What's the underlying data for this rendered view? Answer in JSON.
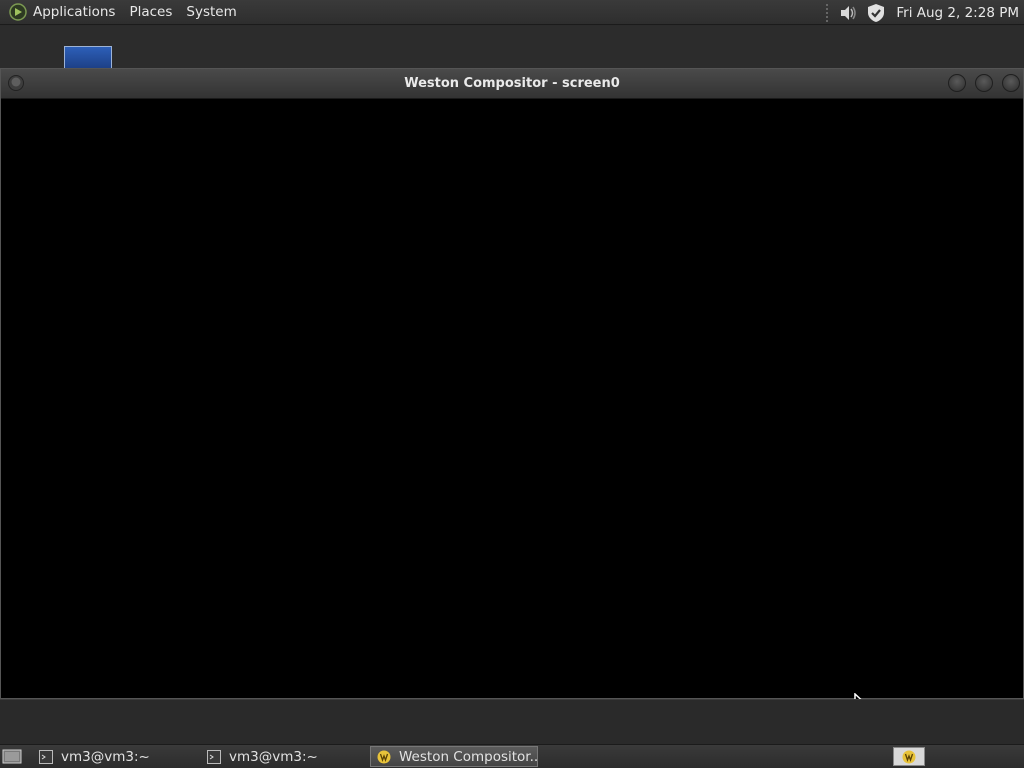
{
  "top_panel": {
    "menus": [
      "Applications",
      "Places",
      "System"
    ],
    "clock": "Fri Aug  2,  2:28 PM"
  },
  "window": {
    "title": "Weston Compositor - screen0"
  },
  "taskbar": {
    "tasks": [
      {
        "label": "vm3@vm3:~",
        "icon": "terminal-icon",
        "active": false
      },
      {
        "label": "vm3@vm3:~",
        "icon": "terminal-icon",
        "active": false
      },
      {
        "label": "Weston Compositor...",
        "icon": "weston-icon",
        "active": true
      }
    ]
  },
  "colors": {
    "panel": "#333333",
    "desktop": "#2c2c2c",
    "window_content": "#000000",
    "weston_icon": "#e8c33a"
  }
}
